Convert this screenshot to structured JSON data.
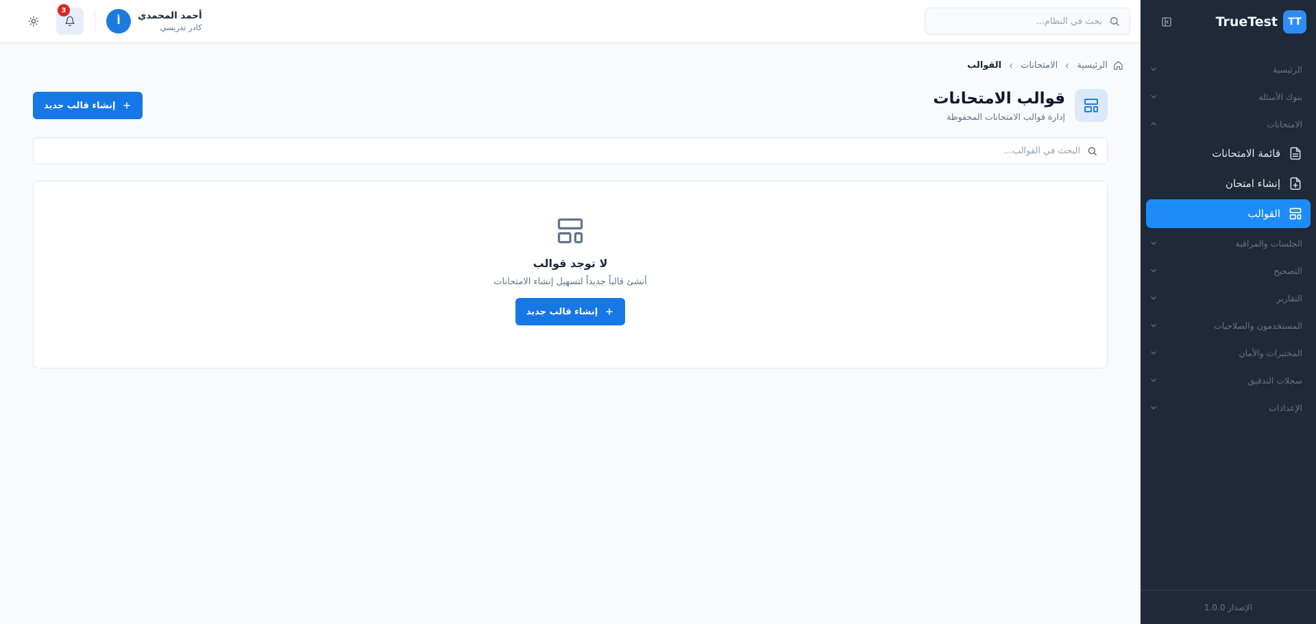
{
  "sidebar": {
    "brand_logo": "TT",
    "brand_name": "TrueTest",
    "groups_top": [
      {
        "label": "الرئيسية"
      },
      {
        "label": "بنوك الأسئلة"
      },
      {
        "label": "الامتحانات"
      }
    ],
    "items": [
      {
        "label": "قائمة الامتحانات",
        "icon": "file-text-icon"
      },
      {
        "label": "إنشاء امتحان",
        "icon": "file-plus-icon"
      },
      {
        "label": "القوالب",
        "icon": "layout-template-icon",
        "active": true
      }
    ],
    "groups_bottom": [
      {
        "label": "الجلسات والمراقبة"
      },
      {
        "label": "التصحيح"
      },
      {
        "label": "التقارير"
      },
      {
        "label": "المستخدمون والصلاحيات"
      },
      {
        "label": "المختبرات والأمان"
      },
      {
        "label": "سجلات التدقيق"
      },
      {
        "label": "الإعدادات"
      }
    ],
    "version": "الإصدار 1.0.0"
  },
  "topbar": {
    "search_placeholder": "بحث في النظام...",
    "notifications_count": "3",
    "user_initial": "أ",
    "user_name": "أحمد المحمدي",
    "user_role": "كادر تدريسي"
  },
  "breadcrumb": {
    "home": "الرئيسية",
    "exams": "الامتحانات",
    "current": "القوالب"
  },
  "page": {
    "title": "قوالب الامتحانات",
    "subtitle": "إدارة قوالب الامتحانات المحفوظة",
    "create_button": "إنشاء قالب جديد",
    "search_placeholder": "البحث في القوالب..."
  },
  "empty_state": {
    "title": "لا توجد قوالب",
    "subtitle": "أنشئ قالباً جديداً لتسهيل إنشاء الامتحانات",
    "button": "إنشاء قالب جديد"
  },
  "colors": {
    "sidebar_bg": "#1f2937",
    "accent": "#1677e6",
    "active_item": "#1d8cf8",
    "badge": "#dc2626"
  }
}
